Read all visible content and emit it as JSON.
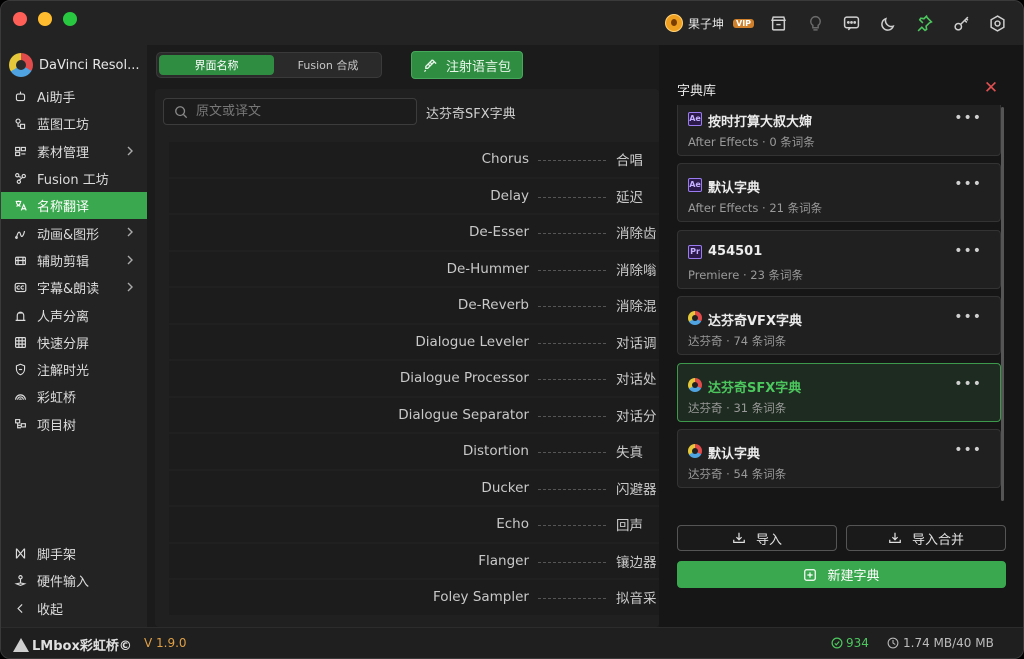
{
  "titlebar": {
    "user_name": "果子坤",
    "vip_label": "VIP",
    "icons": [
      "store-icon",
      "lightbulb-icon",
      "message-icon",
      "moon-icon",
      "pin-icon",
      "key-icon",
      "settings-icon"
    ]
  },
  "sidebar": {
    "brand": "DaVinci Resol...",
    "items": [
      {
        "label": "Ai助手",
        "icon": "robot-icon",
        "chevron": false
      },
      {
        "label": "蓝图工坊",
        "icon": "blueprint-icon",
        "chevron": false
      },
      {
        "label": "素材管理",
        "icon": "material-icon",
        "chevron": true
      },
      {
        "label": "Fusion 工坊",
        "icon": "fusion-icon",
        "chevron": false
      },
      {
        "label": "名称翻译",
        "icon": "translate-icon",
        "chevron": false,
        "active": true
      },
      {
        "label": "动画&图形",
        "icon": "animation-icon",
        "chevron": true
      },
      {
        "label": "辅助剪辑",
        "icon": "edit-icon",
        "chevron": true
      },
      {
        "label": "字幕&朗读",
        "icon": "cc-icon",
        "chevron": true
      },
      {
        "label": "人声分离",
        "icon": "voice-icon",
        "chevron": false
      },
      {
        "label": "快速分屏",
        "icon": "grid-icon",
        "chevron": false
      },
      {
        "label": "注解时光",
        "icon": "shield-icon",
        "chevron": false
      },
      {
        "label": "彩虹桥",
        "icon": "rainbow-icon",
        "chevron": false
      },
      {
        "label": "项目树",
        "icon": "tree-icon",
        "chevron": false
      }
    ],
    "bottom_items": [
      {
        "label": "脚手架",
        "icon": "scaffold-icon"
      },
      {
        "label": "硬件输入",
        "icon": "joystick-icon"
      },
      {
        "label": "收起",
        "icon": "collapse-icon"
      }
    ]
  },
  "main": {
    "tabs": [
      {
        "label": "界面名称",
        "active": true
      },
      {
        "label": "Fusion 合成",
        "active": false
      }
    ],
    "inject_button": "注射语言包",
    "search_placeholder": "原文或译文",
    "dict_name": "达芬奇SFX字典",
    "rows": [
      {
        "src": "Chorus",
        "dst": "合唱"
      },
      {
        "src": "Delay",
        "dst": "延迟"
      },
      {
        "src": "De-Esser",
        "dst": "消除齿"
      },
      {
        "src": "De-Hummer",
        "dst": "消除嗡"
      },
      {
        "src": "De-Reverb",
        "dst": "消除混"
      },
      {
        "src": "Dialogue Leveler",
        "dst": "对话调"
      },
      {
        "src": "Dialogue Processor",
        "dst": "对话处"
      },
      {
        "src": "Dialogue Separator",
        "dst": "对话分"
      },
      {
        "src": "Distortion",
        "dst": "失真"
      },
      {
        "src": "Ducker",
        "dst": "闪避器"
      },
      {
        "src": "Echo",
        "dst": "回声"
      },
      {
        "src": "Flanger",
        "dst": "镶边器"
      },
      {
        "src": "Foley Sampler",
        "dst": "拟音采"
      }
    ]
  },
  "panel": {
    "title": "字典库",
    "close_icon": "close-icon",
    "cards": [
      {
        "badge": "Ae",
        "title": "按时打算大叔大婶",
        "subtitle": "After Effects · 0 条词条",
        "active": false
      },
      {
        "badge": "Ae",
        "title": "默认字典",
        "subtitle": "After Effects · 21 条词条",
        "active": false
      },
      {
        "badge": "Pr",
        "title": "454501",
        "subtitle": "Premiere · 23 条词条",
        "active": false
      },
      {
        "badge": "dv",
        "title": "达芬奇VFX字典",
        "subtitle": "达芬奇 · 74 条词条",
        "active": false
      },
      {
        "badge": "dv",
        "title": "达芬奇SFX字典",
        "subtitle": "达芬奇 · 31 条词条",
        "active": true
      },
      {
        "badge": "dv",
        "title": "默认字典",
        "subtitle": "达芬奇 · 54 条词条",
        "active": false
      }
    ],
    "more_label": "•••",
    "import_button": "导入",
    "import_merge_button": "导入合并",
    "new_button": "新建字典"
  },
  "status": {
    "logo_text": "LMbox彩虹桥©",
    "version": "V 1.9.0",
    "count": "934",
    "memory": "1.74 MB/40 MB"
  },
  "colors": {
    "accent": "#3aa84e",
    "version": "#e0a046",
    "close": "#e05050"
  }
}
